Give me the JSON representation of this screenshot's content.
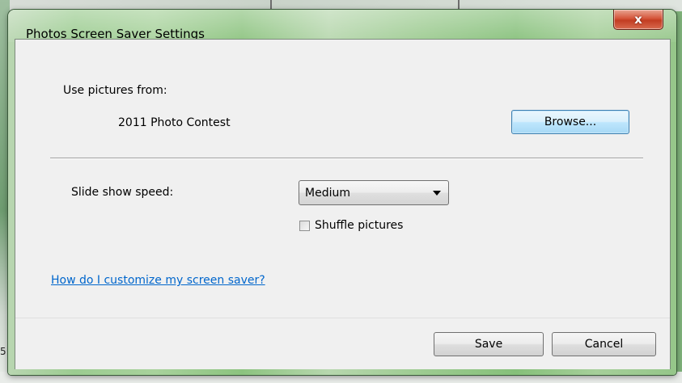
{
  "window": {
    "title": "Photos Screen Saver Settings",
    "close_label": "x"
  },
  "pictures": {
    "label": "Use pictures from:",
    "source": "2011 Photo Contest",
    "browse_label": "Browse..."
  },
  "speed": {
    "label": "Slide show speed:",
    "selected": "Medium"
  },
  "shuffle": {
    "label": "Shuffle pictures",
    "checked": false
  },
  "help_link": "How do I customize my screen saver?",
  "footer": {
    "save_label": "Save",
    "cancel_label": "Cancel"
  },
  "background": {
    "glyph": "5"
  },
  "colors": {
    "link": "#0066cc",
    "close_button": "#c23d22",
    "dialog_background": "#f0f0f0"
  }
}
